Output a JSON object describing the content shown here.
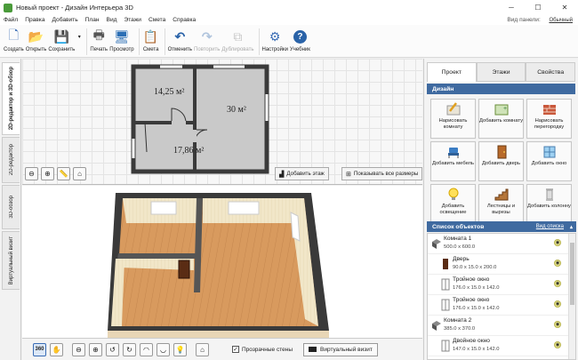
{
  "window": {
    "title": "Новый проект - Дизайн Интерьера 3D"
  },
  "menu": {
    "items": [
      "Файл",
      "Правка",
      "Добавить",
      "План",
      "Вид",
      "Этажи",
      "Смета",
      "Справка"
    ],
    "view_panel_label": "Вид панели:",
    "view_panel_value": "Обычный"
  },
  "toolbar": {
    "buttons": [
      {
        "label": "Создать",
        "icon": "new-file-icon",
        "glyph": "🗋"
      },
      {
        "label": "Открыть",
        "icon": "open-folder-icon",
        "glyph": "📂"
      },
      {
        "label": "Сохранить",
        "icon": "save-icon",
        "glyph": "💾"
      },
      {
        "label": "Печать",
        "icon": "print-icon",
        "glyph": "🖶"
      },
      {
        "label": "Просмотр",
        "icon": "monitor-icon",
        "glyph": "🖥"
      },
      {
        "label": "Смета",
        "icon": "estimate-icon",
        "glyph": "📋"
      },
      {
        "label": "Отменить",
        "icon": "undo-icon",
        "glyph": "↶"
      },
      {
        "label": "Повторить",
        "icon": "redo-icon",
        "glyph": "↷"
      },
      {
        "label": "Дублировать",
        "icon": "duplicate-icon",
        "glyph": "⧉"
      },
      {
        "label": "Настройки",
        "icon": "gear-icon",
        "glyph": "⚙"
      },
      {
        "label": "Учебник",
        "icon": "help-icon",
        "glyph": "?"
      }
    ]
  },
  "left_tabs": [
    "2D-редактор и 3D-обзор",
    "2D-редактор",
    "3D-обзор",
    "Виртуальный визит"
  ],
  "plan": {
    "rooms": [
      {
        "area": "14,25 м²"
      },
      {
        "area": "30 м²"
      },
      {
        "area": "17,86 м²"
      }
    ]
  },
  "plan_buttons": {
    "add_floor": "Добавить этаж",
    "show_all_sizes": "Показывать все размеры"
  },
  "bottom": {
    "mode_label": "360",
    "transparent_walls": "Прозрачные стены",
    "transparent_checked": true,
    "virtual_visit": "Виртуальный визит"
  },
  "right_panel": {
    "tabs": [
      "Проект",
      "Этажи",
      "Свойства"
    ],
    "design_header": "Дизайн",
    "design_buttons": [
      {
        "label": "Нарисовать комнату",
        "icon": "pencil-room-icon"
      },
      {
        "label": "Добавить комнату",
        "icon": "add-room-icon"
      },
      {
        "label": "Нарисовать перегородку",
        "icon": "brick-wall-icon"
      },
      {
        "label": "Добавить мебель",
        "icon": "chair-icon"
      },
      {
        "label": "Добавить дверь",
        "icon": "door-icon"
      },
      {
        "label": "Добавить окно",
        "icon": "window-icon"
      },
      {
        "label": "Добавить освещение",
        "icon": "lightbulb-icon"
      },
      {
        "label": "Лестницы и вырезы",
        "icon": "stairs-icon"
      },
      {
        "label": "Добавить колонну",
        "icon": "column-icon"
      }
    ],
    "list_header": "Список объектов",
    "list_view_label": "Вид списка",
    "objects": [
      {
        "name": "Комната 1",
        "dims": "500.0 x 600.0",
        "type": "room",
        "indent": 0
      },
      {
        "name": "Дверь",
        "dims": "90.0 x 15.0 x 200.0",
        "type": "door",
        "indent": 1
      },
      {
        "name": "Тройное окно",
        "dims": "176.0 x 15.0 x 142.0",
        "type": "window",
        "indent": 1
      },
      {
        "name": "Тройное окно",
        "dims": "176.0 x 15.0 x 142.0",
        "type": "window",
        "indent": 1
      },
      {
        "name": "Комната 2",
        "dims": "385.0 x 370.0",
        "type": "room",
        "indent": 0
      },
      {
        "name": "Двойное окно",
        "dims": "147.0 x 15.0 x 142.0",
        "type": "window",
        "indent": 1
      }
    ]
  }
}
